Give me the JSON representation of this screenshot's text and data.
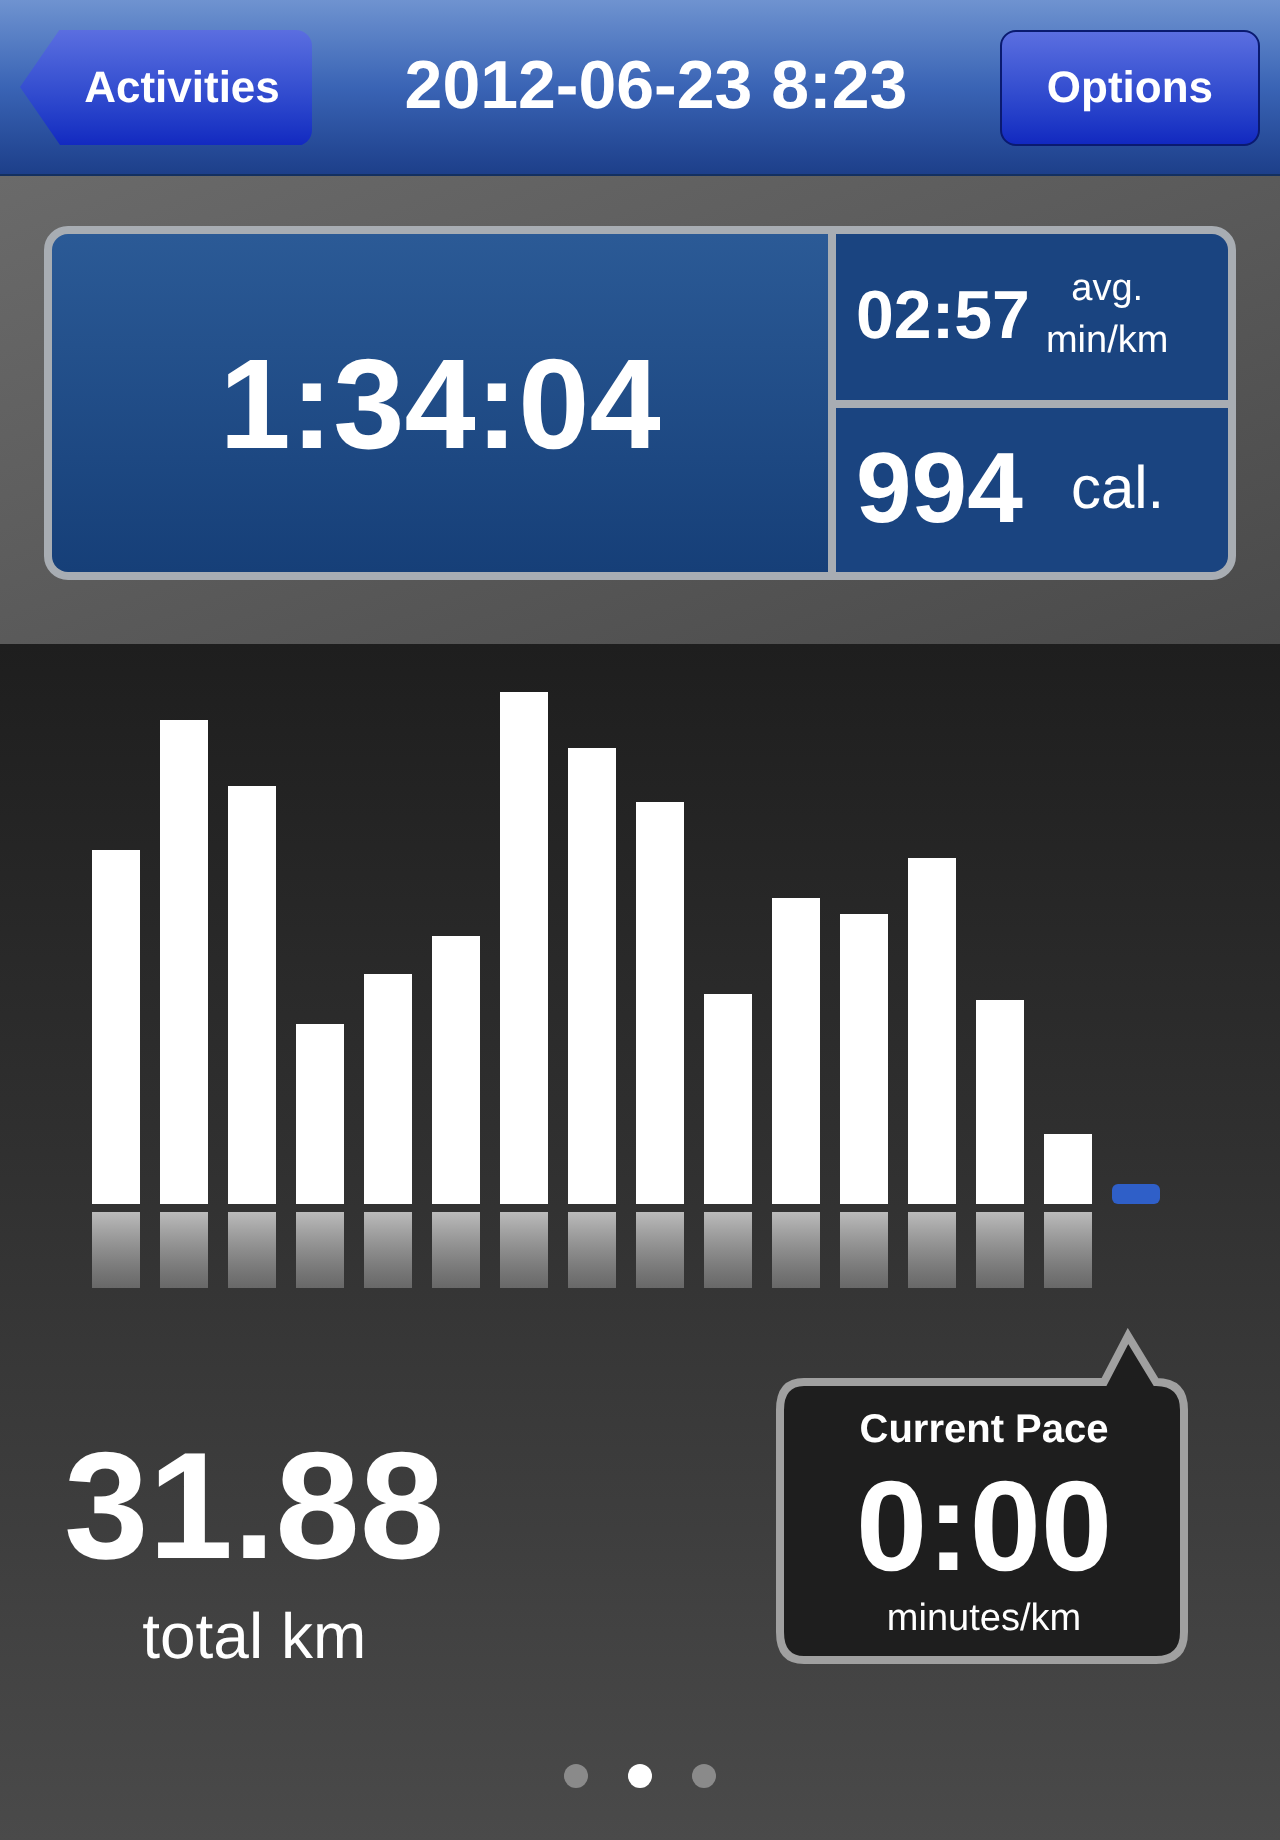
{
  "nav_bar": {
    "back_button": "Activities",
    "title": "2012-06-23 8:23",
    "options_button": "Options"
  },
  "stats": {
    "duration": "1:34:04",
    "pace": {
      "value": "02:57",
      "unit_line_1": "avg.",
      "unit_line_2": "min/km"
    },
    "calories": {
      "value": "994",
      "unit": "cal."
    }
  },
  "distance": {
    "value": "31.88",
    "unit": "total km"
  },
  "current_pace": {
    "label": "Current Pace",
    "value": "0:00",
    "unit": "minutes/km"
  },
  "page_dots": [
    {
      "selected": false
    },
    {
      "selected": true
    },
    {
      "selected": false
    }
  ]
}
